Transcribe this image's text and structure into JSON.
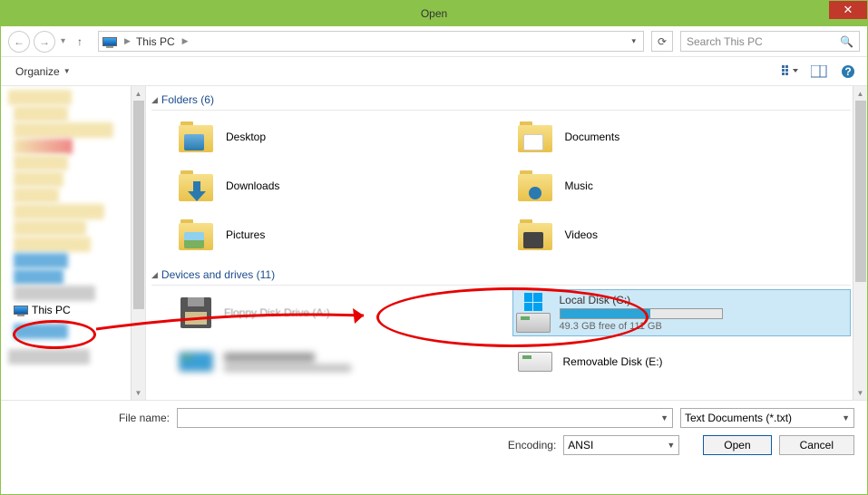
{
  "title": "Open",
  "breadcrumb": {
    "location": "This PC"
  },
  "search": {
    "placeholder": "Search This PC"
  },
  "toolbar": {
    "organize": "Organize"
  },
  "sidebar": {
    "thispc": "This PC"
  },
  "sections": {
    "folders": {
      "label": "Folders (6)"
    },
    "drives": {
      "label": "Devices and drives (11)"
    }
  },
  "folders": [
    {
      "name": "Desktop"
    },
    {
      "name": "Documents"
    },
    {
      "name": "Downloads"
    },
    {
      "name": "Music"
    },
    {
      "name": "Pictures"
    },
    {
      "name": "Videos"
    }
  ],
  "drives": {
    "floppy": {
      "name": "Floppy Disk Drive (A:)"
    },
    "local": {
      "name": "Local Disk (C:)",
      "free": "49.3 GB free of 111 GB",
      "fill_pct": 56
    },
    "removable": {
      "name": "Removable Disk (E:)"
    }
  },
  "bottom": {
    "filename_label": "File name:",
    "filename_value": "",
    "filetype": "Text Documents (*.txt)",
    "encoding_label": "Encoding:",
    "encoding_value": "ANSI",
    "open": "Open",
    "cancel": "Cancel"
  }
}
